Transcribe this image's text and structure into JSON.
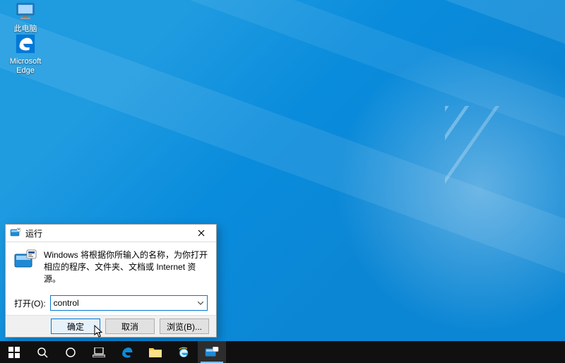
{
  "desktop": {
    "icons": [
      {
        "name": "this-pc",
        "label": "此电脑"
      },
      {
        "name": "edge",
        "label": "Microsoft Edge"
      }
    ]
  },
  "run_dialog": {
    "title": "运行",
    "message": "Windows 将根据你所输入的名称，为你打开相应的程序、文件夹、文档或 Internet 资源。",
    "open_label": "打开(O):",
    "open_value": "control",
    "buttons": {
      "ok": "确定",
      "cancel": "取消",
      "browse": "浏览(B)..."
    }
  },
  "taskbar": {
    "items": [
      {
        "name": "start",
        "icon": "windows-logo-icon"
      },
      {
        "name": "search",
        "icon": "search-icon"
      },
      {
        "name": "cortana",
        "icon": "cortana-icon"
      },
      {
        "name": "task-view",
        "icon": "task-view-icon"
      },
      {
        "name": "edge",
        "icon": "edge-icon"
      },
      {
        "name": "file-explorer",
        "icon": "file-explorer-icon"
      },
      {
        "name": "ie",
        "icon": "ie-icon"
      },
      {
        "name": "run-dialog",
        "icon": "run-icon",
        "active": true
      }
    ]
  }
}
